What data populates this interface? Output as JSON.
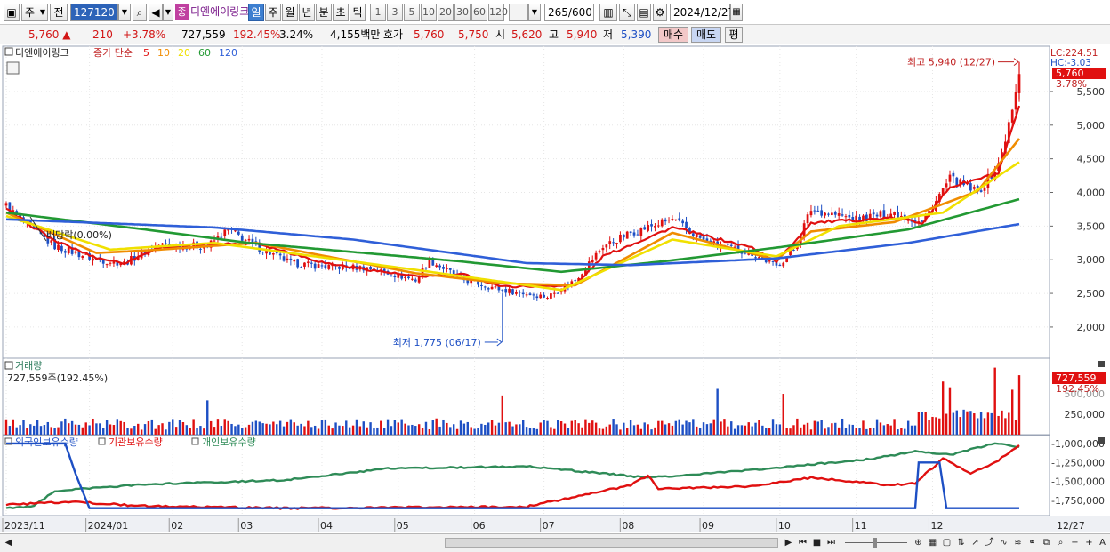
{
  "toolbar": {
    "market_label": "주",
    "prev_label": "전",
    "code_value": "127120",
    "stock_name": "디엔에이링크",
    "stock_badge": "종",
    "period_tabs": [
      {
        "label": "일",
        "active": true
      },
      {
        "label": "주",
        "active": false
      },
      {
        "label": "월",
        "active": false
      },
      {
        "label": "년",
        "active": false
      },
      {
        "label": "분",
        "active": false
      },
      {
        "label": "초",
        "active": false
      },
      {
        "label": "틱",
        "active": false
      }
    ],
    "intervals": [
      "1",
      "3",
      "5",
      "10",
      "20",
      "30",
      "60",
      "120"
    ],
    "count_value": "265",
    "count_total": "/600",
    "date_value": "2024/12/27"
  },
  "quote": {
    "price": "5,760",
    "change_arrow": "▲",
    "change": "210",
    "change_pct": "+3.78%",
    "volume": "727,559",
    "volume_ratio": "192.45%",
    "turnover_pct": "3.24%",
    "amount": "4,155백만",
    "bid_label": "호가",
    "ask_price": "5,760",
    "bid_price": "5,750",
    "open_label": "시",
    "open": "5,620",
    "high_label": "고",
    "high": "5,940",
    "low_label": "저",
    "low": "5,390",
    "buy_label": "매수",
    "sell_label": "매도",
    "eval_label": "평"
  },
  "chart_data": {
    "type": "candlestick",
    "price_panel": {
      "title": "디엔에이링크",
      "legend_prefix": "종가 단순",
      "ma_periods": [
        "5",
        "10",
        "20",
        "60",
        "120"
      ],
      "ma_colors": [
        "#e01010",
        "#f08c00",
        "#f0e000",
        "#229933",
        "#2f5fd8"
      ],
      "y_ticks": [
        2000,
        2500,
        3000,
        3500,
        4000,
        4500,
        5000,
        5500
      ],
      "y_tick_labels": [
        "2,000",
        "2,500",
        "3,000",
        "3,500",
        "4,000",
        "4,500",
        "5,000",
        "5,500"
      ],
      "ylim": [
        1550,
        6120
      ],
      "corner_lc": "LC:224.51",
      "corner_hc": "HC:-3.03",
      "last_price_label": "5,760",
      "last_pct_label": "3.78%",
      "high_annotation": "최고 5,940 (12/27)",
      "low_annotation": "최저 1,775 (06/17)",
      "event_label": "배당락(0.00%)",
      "anchors": [
        [
          0,
          3800
        ],
        [
          5,
          3550
        ],
        [
          14,
          3200
        ],
        [
          26,
          3000
        ],
        [
          34,
          2950
        ],
        [
          44,
          3220
        ],
        [
          58,
          3200
        ],
        [
          64,
          3450
        ],
        [
          72,
          3200
        ],
        [
          82,
          2950
        ],
        [
          92,
          2900
        ],
        [
          104,
          2880
        ],
        [
          118,
          2700
        ],
        [
          122,
          2990
        ],
        [
          132,
          2700
        ],
        [
          143,
          2550
        ],
        [
          156,
          2450
        ],
        [
          164,
          2700
        ],
        [
          172,
          3200
        ],
        [
          180,
          3400
        ],
        [
          192,
          3600
        ],
        [
          202,
          3250
        ],
        [
          215,
          3100
        ],
        [
          222,
          2900
        ],
        [
          227,
          3150
        ],
        [
          232,
          3750
        ],
        [
          245,
          3600
        ],
        [
          256,
          3700
        ],
        [
          264,
          3550
        ],
        [
          272,
          4200
        ],
        [
          280,
          4000
        ],
        [
          286,
          4400
        ],
        [
          290,
          5200
        ],
        [
          292,
          5760
        ]
      ],
      "ma_anchors": {
        "5": [
          [
            0,
            3750
          ],
          [
            14,
            3280
          ],
          [
            26,
            3030
          ],
          [
            34,
            2950
          ],
          [
            44,
            3180
          ],
          [
            60,
            3230
          ],
          [
            72,
            3250
          ],
          [
            92,
            2950
          ],
          [
            118,
            2750
          ],
          [
            132,
            2780
          ],
          [
            143,
            2600
          ],
          [
            164,
            2620
          ],
          [
            172,
            3050
          ],
          [
            192,
            3480
          ],
          [
            215,
            3180
          ],
          [
            222,
            2970
          ],
          [
            232,
            3550
          ],
          [
            256,
            3620
          ],
          [
            264,
            3550
          ],
          [
            272,
            4080
          ],
          [
            286,
            4280
          ],
          [
            292,
            5280
          ]
        ],
        "10": [
          [
            0,
            3700
          ],
          [
            26,
            3100
          ],
          [
            44,
            3150
          ],
          [
            72,
            3250
          ],
          [
            118,
            2800
          ],
          [
            143,
            2650
          ],
          [
            164,
            2620
          ],
          [
            192,
            3400
          ],
          [
            222,
            3000
          ],
          [
            232,
            3420
          ],
          [
            256,
            3560
          ],
          [
            280,
            4020
          ],
          [
            292,
            4800
          ]
        ],
        "20": [
          [
            0,
            3650
          ],
          [
            30,
            3150
          ],
          [
            60,
            3250
          ],
          [
            118,
            2850
          ],
          [
            160,
            2550
          ],
          [
            192,
            3300
          ],
          [
            222,
            3050
          ],
          [
            240,
            3500
          ],
          [
            270,
            3700
          ],
          [
            292,
            4450
          ]
        ],
        "60": [
          [
            0,
            3700
          ],
          [
            40,
            3450
          ],
          [
            70,
            3250
          ],
          [
            130,
            2980
          ],
          [
            160,
            2820
          ],
          [
            190,
            2980
          ],
          [
            222,
            3180
          ],
          [
            260,
            3450
          ],
          [
            292,
            3900
          ]
        ],
        "120": [
          [
            0,
            3600
          ],
          [
            60,
            3480
          ],
          [
            100,
            3300
          ],
          [
            150,
            2950
          ],
          [
            180,
            2920
          ],
          [
            222,
            3020
          ],
          [
            260,
            3250
          ],
          [
            292,
            3530
          ]
        ]
      }
    },
    "volume_panel": {
      "title": "거래량",
      "subtitle": "727,559주(192.45%)",
      "y_ticks": [
        250000
      ],
      "y_tick_labels": [
        "250,000"
      ],
      "partial_tick_label": "500,000",
      "ylim": [
        0,
        870000
      ],
      "last_value_label": "727,559",
      "last_pct_label": "192.45%",
      "spikes": [
        [
          58,
          420000
        ],
        [
          143,
          480000
        ],
        [
          205,
          560000
        ],
        [
          224,
          500000
        ],
        [
          270,
          650000
        ],
        [
          272,
          580000
        ],
        [
          285,
          820000
        ],
        [
          290,
          550000
        ],
        [
          292,
          727559
        ]
      ]
    },
    "holdings_panel": {
      "series_names": [
        "외국인보유수량",
        "기관보유수량",
        "개인보유수량"
      ],
      "series_colors": [
        "#1d4fc4",
        "#e01010",
        "#2e8b57"
      ],
      "y_ticks": [
        -1000000,
        -1250000,
        -1500000,
        -1750000
      ],
      "y_tick_labels": [
        "-1,000,000",
        "-1,250,000",
        "-1,500,000",
        "-1,750,000"
      ],
      "ylim": [
        -1900000,
        -920000
      ],
      "foreign": [
        [
          0,
          -1000000
        ],
        [
          17,
          -1000000
        ],
        [
          20,
          -1400000
        ],
        [
          24,
          -1850000
        ],
        [
          262,
          -1850000
        ],
        [
          263,
          -1250000
        ],
        [
          269,
          -1250000
        ],
        [
          271,
          -1850000
        ],
        [
          292,
          -1850000
        ]
      ],
      "institution": [
        [
          0,
          -1800000
        ],
        [
          20,
          -1770000
        ],
        [
          40,
          -1820000
        ],
        [
          80,
          -1850000
        ],
        [
          150,
          -1830000
        ],
        [
          170,
          -1640000
        ],
        [
          180,
          -1550000
        ],
        [
          185,
          -1420000
        ],
        [
          188,
          -1600000
        ],
        [
          215,
          -1560000
        ],
        [
          232,
          -1450000
        ],
        [
          255,
          -1550000
        ],
        [
          262,
          -1520000
        ],
        [
          270,
          -1200000
        ],
        [
          278,
          -1400000
        ],
        [
          285,
          -1250000
        ],
        [
          292,
          -1020000
        ]
      ],
      "individual": [
        [
          0,
          -1850000
        ],
        [
          8,
          -1820000
        ],
        [
          14,
          -1620000
        ],
        [
          40,
          -1540000
        ],
        [
          80,
          -1480000
        ],
        [
          110,
          -1330000
        ],
        [
          150,
          -1300000
        ],
        [
          185,
          -1450000
        ],
        [
          215,
          -1350000
        ],
        [
          250,
          -1200000
        ],
        [
          262,
          -1100000
        ],
        [
          272,
          -1150000
        ],
        [
          285,
          -1000000
        ],
        [
          292,
          -1050000
        ]
      ]
    },
    "x_labels": [
      {
        "i": 0,
        "label": "2023/11"
      },
      {
        "i": 24,
        "label": "2024/01"
      },
      {
        "i": 48,
        "label": "02"
      },
      {
        "i": 68,
        "label": "03"
      },
      {
        "i": 91,
        "label": "04"
      },
      {
        "i": 113,
        "label": "05"
      },
      {
        "i": 135,
        "label": "06"
      },
      {
        "i": 155,
        "label": "07"
      },
      {
        "i": 178,
        "label": "08"
      },
      {
        "i": 201,
        "label": "09"
      },
      {
        "i": 223,
        "label": "10"
      },
      {
        "i": 245,
        "label": "11"
      },
      {
        "i": 267,
        "label": "12"
      }
    ],
    "right_date_label": "12/27",
    "n_bars": 293,
    "colors": {
      "up": "#e01010",
      "down": "#1d4fc4"
    }
  }
}
